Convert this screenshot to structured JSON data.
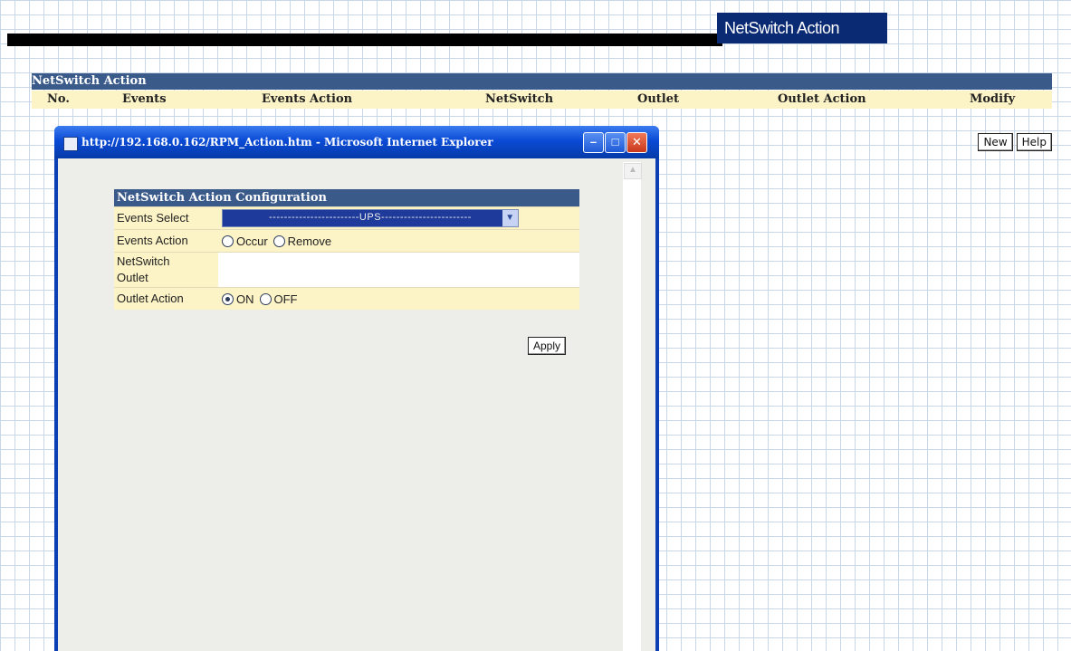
{
  "banner": {
    "title": "NetSwitch Action"
  },
  "section": {
    "title": "NetSwitch Action"
  },
  "columns": [
    "No.",
    "Events",
    "Events Action",
    "NetSwitch",
    "Outlet",
    "Outlet Action",
    "Modify"
  ],
  "side_buttons": {
    "new_label": "New",
    "help_label": "Help"
  },
  "popup": {
    "title": "http://192.168.0.162/RPM_Action.htm - Microsoft Internet Explorer",
    "controls": {
      "minimize": "–",
      "maximize": "□",
      "close": "✕"
    },
    "config": {
      "title": "NetSwitch Action Configuration",
      "events_select": {
        "label": "Events Select",
        "value": "------------------------UPS------------------------"
      },
      "events_action": {
        "label": "Events Action",
        "options": [
          "Occur",
          "Remove"
        ]
      },
      "netswitch": {
        "label": "NetSwitch"
      },
      "outlet": {
        "label": "Outlet"
      },
      "outlet_action": {
        "label": "Outlet Action",
        "options": [
          "ON",
          "OFF"
        ],
        "selected": "ON"
      },
      "apply_label": "Apply"
    }
  }
}
